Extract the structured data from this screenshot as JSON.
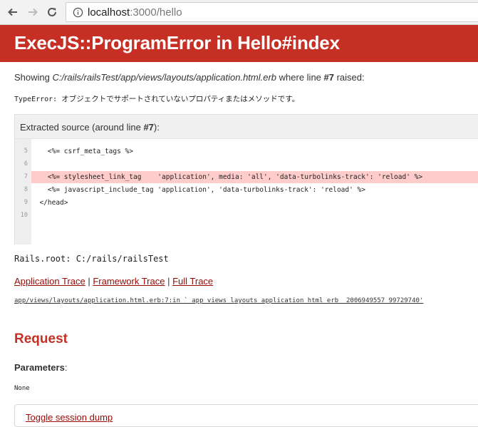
{
  "browser": {
    "url_host": "localhost",
    "url_rest": ":3000/hello"
  },
  "error": {
    "title": "ExecJS::ProgramError in Hello#index",
    "showing_prefix": "Showing ",
    "showing_file": "C:/rails/railsTest/app/views/layouts/application.html.erb",
    "showing_mid": " where line ",
    "showing_line": "#7",
    "showing_suffix": " raised:",
    "type_label": "TypeError: ",
    "type_message": "オブジェクトでサポートされていないプロパティまたはメソッドです。"
  },
  "source": {
    "title_prefix": "Extracted source (around line ",
    "title_line": "#7",
    "title_suffix": "):",
    "lines": [
      {
        "num": "5",
        "code": "    <%= csrf_meta_tags %>"
      },
      {
        "num": "6",
        "code": ""
      },
      {
        "num": "7",
        "code": "    <%= stylesheet_link_tag    'application', media: 'all', 'data-turbolinks-track': 'reload' %>"
      },
      {
        "num": "8",
        "code": "    <%= javascript_include_tag 'application', 'data-turbolinks-track': 'reload' %>"
      },
      {
        "num": "9",
        "code": "  </head>"
      },
      {
        "num": "10",
        "code": ""
      }
    ]
  },
  "rails_root": "Rails.root: C:/rails/railsTest",
  "traces": {
    "application": "Application Trace",
    "framework": "Framework Trace",
    "full": "Full Trace",
    "separator": " | ",
    "trace_line": "app/views/layouts/application.html.erb:7:in `_app_views_layouts_application_html_erb__2006949557_99729740'"
  },
  "request": {
    "title": "Request",
    "parameters_label": "Parameters",
    "parameters_colon": ":",
    "parameters_value": "None",
    "toggle_session": "Toggle session dump"
  },
  "colors": {
    "header_red": "#c52f24",
    "link_red": "#980905",
    "highlight": "#ffcccc"
  }
}
